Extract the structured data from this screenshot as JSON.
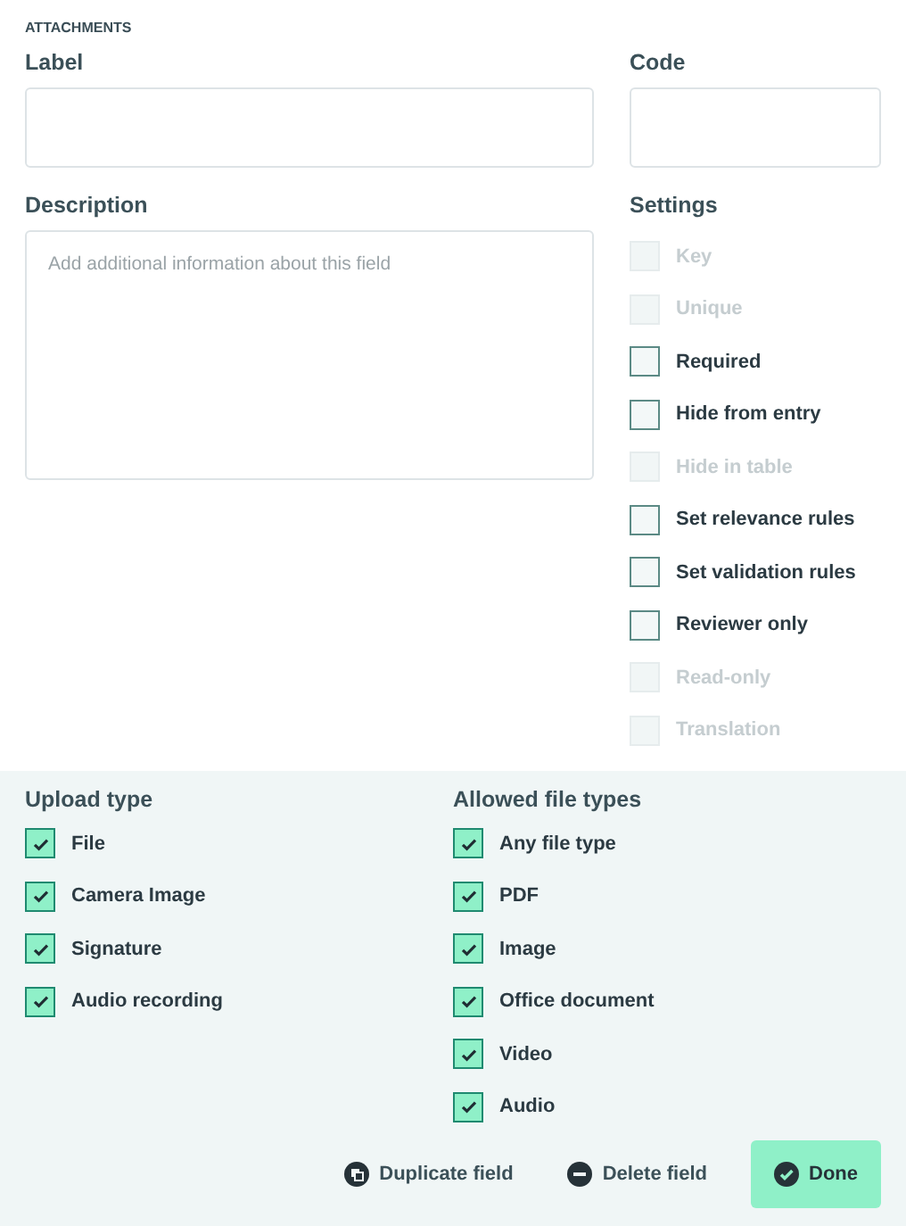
{
  "section_title": "ATTACHMENTS",
  "label_field": {
    "label": "Label"
  },
  "code_field": {
    "label": "Code"
  },
  "description_field": {
    "label": "Description",
    "placeholder": "Add additional information about this field"
  },
  "settings": {
    "title": "Settings",
    "items": [
      {
        "label": "Key",
        "checked": false,
        "disabled": true
      },
      {
        "label": "Unique",
        "checked": false,
        "disabled": true
      },
      {
        "label": "Required",
        "checked": false,
        "disabled": false
      },
      {
        "label": "Hide from entry",
        "checked": false,
        "disabled": false
      },
      {
        "label": "Hide in table",
        "checked": false,
        "disabled": true
      },
      {
        "label": "Set relevance rules",
        "checked": false,
        "disabled": false
      },
      {
        "label": "Set validation rules",
        "checked": false,
        "disabled": false
      },
      {
        "label": "Reviewer only",
        "checked": false,
        "disabled": false
      },
      {
        "label": "Read-only",
        "checked": false,
        "disabled": true
      },
      {
        "label": "Translation",
        "checked": false,
        "disabled": true
      }
    ]
  },
  "upload_type": {
    "title": "Upload type",
    "items": [
      {
        "label": "File",
        "checked": true
      },
      {
        "label": "Camera Image",
        "checked": true
      },
      {
        "label": "Signature",
        "checked": true
      },
      {
        "label": "Audio recording",
        "checked": true
      }
    ]
  },
  "allowed_file_types": {
    "title": "Allowed file types",
    "items": [
      {
        "label": "Any file type",
        "checked": true
      },
      {
        "label": "PDF",
        "checked": true
      },
      {
        "label": "Image",
        "checked": true
      },
      {
        "label": "Office document",
        "checked": true
      },
      {
        "label": "Video",
        "checked": true
      },
      {
        "label": "Audio",
        "checked": true
      }
    ]
  },
  "actions": [
    {
      "label": "Duplicate field",
      "kind": "duplicate"
    },
    {
      "label": "Delete field",
      "kind": "delete"
    },
    {
      "label": "Done",
      "kind": "done"
    }
  ]
}
